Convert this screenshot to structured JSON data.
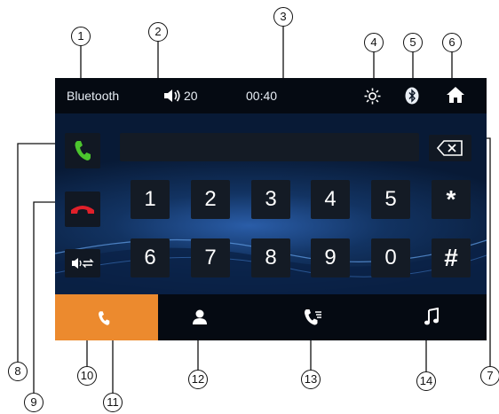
{
  "status_bar": {
    "source_label": "Bluetooth",
    "volume_level": "20",
    "clock": "00:40",
    "icons": [
      "speaker-icon",
      "brightness-icon",
      "bluetooth-icon",
      "home-icon"
    ]
  },
  "dialer": {
    "number_value": "",
    "action_icons": [
      "phone-call-icon",
      "phone-hangup-icon",
      "audio-transfer-icon",
      "backspace-icon"
    ],
    "keys_row1": [
      "1",
      "2",
      "3",
      "4",
      "5",
      "*"
    ],
    "keys_row2": [
      "6",
      "7",
      "8",
      "9",
      "0",
      "#"
    ]
  },
  "bottom_nav": {
    "tabs": [
      {
        "icon": "phone-icon",
        "active": true
      },
      {
        "icon": "contacts-icon",
        "active": false
      },
      {
        "icon": "call-log-icon",
        "active": false
      },
      {
        "icon": "music-note-icon",
        "active": false
      }
    ]
  },
  "callouts": {
    "c1": "1",
    "c2": "2",
    "c3": "3",
    "c4": "4",
    "c5": "5",
    "c6": "6",
    "c7": "7",
    "c8": "8",
    "c9": "9",
    "c10": "10",
    "c11": "11",
    "c12": "12",
    "c13": "13",
    "c14": "14"
  },
  "colors": {
    "accent_tab": "#ec8a2e",
    "call_green": "#4cc52e",
    "hangup_red": "#e0202a",
    "screen_bg": "#0c1a2e"
  }
}
